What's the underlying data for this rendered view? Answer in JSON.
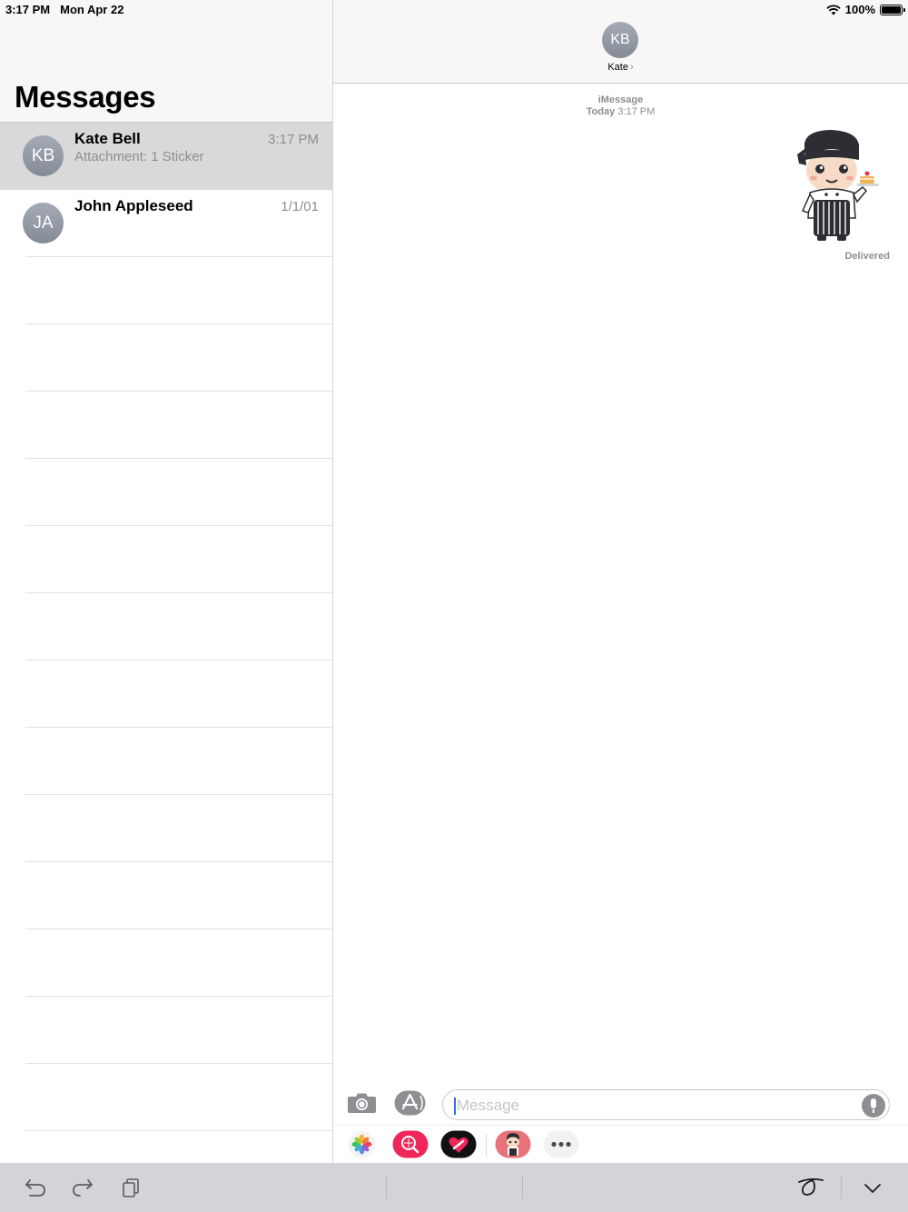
{
  "status_bar": {
    "time": "3:17 PM",
    "date": "Mon Apr 22",
    "battery": "100%",
    "battery_level": 1.0,
    "wifi_icon": "wifi-icon"
  },
  "sidebar": {
    "title": "Messages",
    "conversations": [
      {
        "initials": "KB",
        "name": "Kate Bell",
        "preview": "Attachment: 1 Sticker",
        "time": "3:17 PM",
        "selected": true
      },
      {
        "initials": "JA",
        "name": "John Appleseed",
        "preview": "",
        "time": "1/1/01",
        "selected": false
      }
    ]
  },
  "conversation": {
    "contact_initials": "KB",
    "contact_name": "Kate",
    "chevron": "›",
    "service": "iMessage",
    "day": "Today",
    "time": "3:17 PM",
    "sticker_icon": "chef-sticker-icon",
    "status": "Delivered"
  },
  "compose": {
    "placeholder": "Message",
    "value": "",
    "camera_icon": "camera-icon",
    "appstore_icon": "app-store-icon",
    "mic_icon": "microphone-icon"
  },
  "app_tray": [
    "photos-icon",
    "image-search-icon",
    "digital-touch-icon",
    "chef-sticker-app-icon",
    "more-icon"
  ],
  "keyboard_bar": [
    "undo-icon",
    "redo-icon",
    "paste-icon",
    "handwriting-icon",
    "dismiss-keyboard-icon"
  ],
  "colors": {
    "accent": "#2f6bf0",
    "selected_row": "#d9d9d9",
    "secondary_text": "#8e8e93",
    "avatar": "#9aa0aa",
    "image_search": "#f0265a",
    "keyboard_bar": "#d2d4d9"
  }
}
